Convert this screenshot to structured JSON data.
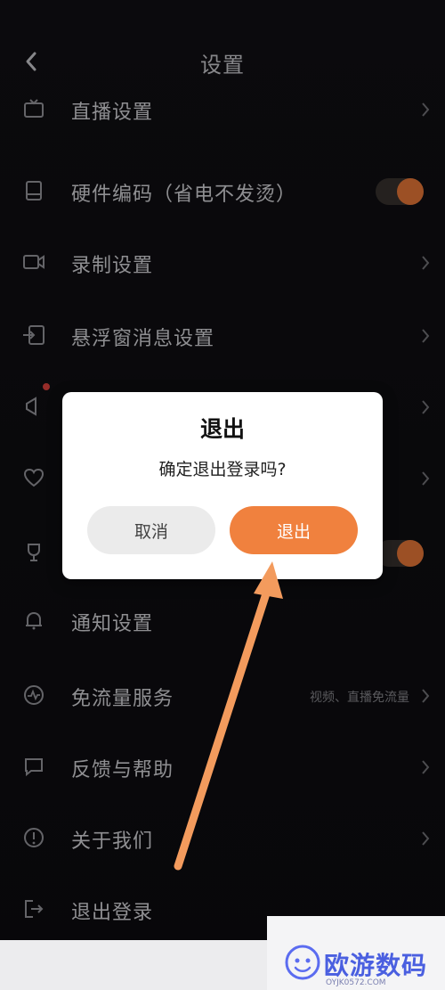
{
  "header": {
    "title": "设置"
  },
  "rows": [
    {
      "label": "直播设置"
    },
    {
      "label": "硬件编码（省电不发烫）"
    },
    {
      "label": "录制设置"
    },
    {
      "label": "悬浮窗消息设置"
    },
    {
      "label": "通知设置"
    },
    {
      "label": "免流量服务",
      "sub": "视频、直播免流量"
    },
    {
      "label": "反馈与帮助"
    },
    {
      "label": "关于我们"
    },
    {
      "label": "退出登录"
    }
  ],
  "dialog": {
    "title": "退出",
    "message": "确定退出登录吗?",
    "cancel_label": "取消",
    "confirm_label": "退出"
  },
  "colors": {
    "accent": "#f0813e",
    "background": "#111014",
    "dialog": "#ffffff",
    "badge": "#e7443f"
  },
  "watermark": {
    "name": "欧游数码",
    "url": "OYJK0572.COM"
  }
}
